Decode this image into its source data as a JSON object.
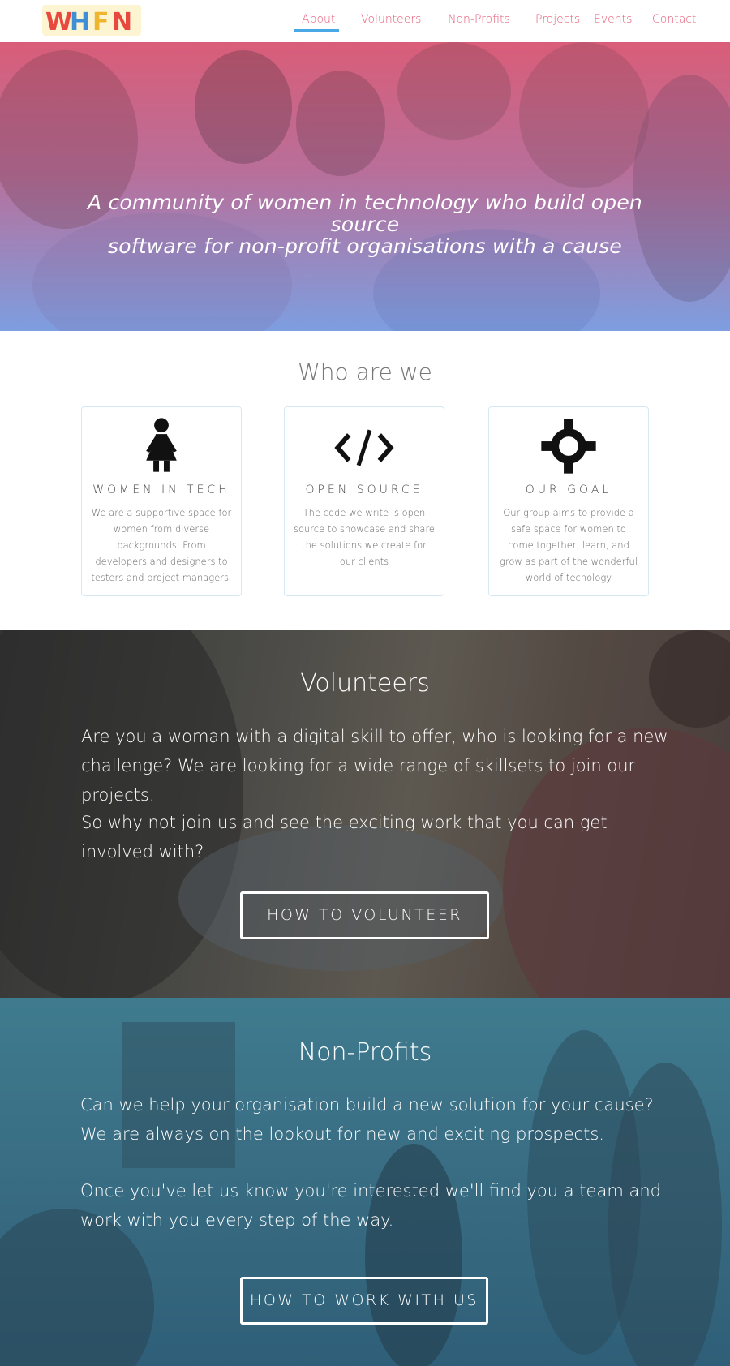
{
  "nav": {
    "items": [
      "About",
      "Volunteers",
      "Non-Profits",
      "Projects",
      "Events",
      "Contact"
    ],
    "active": "About",
    "logo_text": "WHFN"
  },
  "hero": {
    "tagline_line1": "A community of women in technology who build open source",
    "tagline_line2": "software for non-profit organisations with a cause"
  },
  "who": {
    "title": "Who are we",
    "cards": [
      {
        "icon": "woman-icon",
        "title": "WOMEN IN TECH",
        "text": "We are a supportive space for women from diverse backgrounds. From developers and designers to testers and project managers."
      },
      {
        "icon": "code-icon",
        "title": "OPEN SOURCE",
        "text": "The code we write is open source to showcase and share the solutions we create for our clients"
      },
      {
        "icon": "crosshair-icon",
        "title": "OUR GOAL",
        "text": "Our group aims to provide a safe space for women to come together, learn, and grow as part of the wonderful world of techology"
      }
    ]
  },
  "volunteers": {
    "title": "Volunteers",
    "p1": "Are you a woman with a digital skill to offer, who is looking for a new challenge? We are looking for a wide range of skillsets to join our projects.",
    "p2": "So why not join us and see the exciting work that you can get involved with?",
    "button": "HOW TO VOLUNTEER"
  },
  "nonprofits": {
    "title": "Non-Profits",
    "p1": "Can we help your organisation build a new solution for your cause? We are always on the lookout for new and exciting prospects.",
    "p2": "Once you've let us know you're interested we'll find you a team and work with you every step of the way.",
    "button": "HOW TO WORK WITH US"
  },
  "colors": {
    "nav_link": "#e45a75",
    "nav_active_underline": "#4aa8e6",
    "card_border": "#d6e8f4"
  }
}
